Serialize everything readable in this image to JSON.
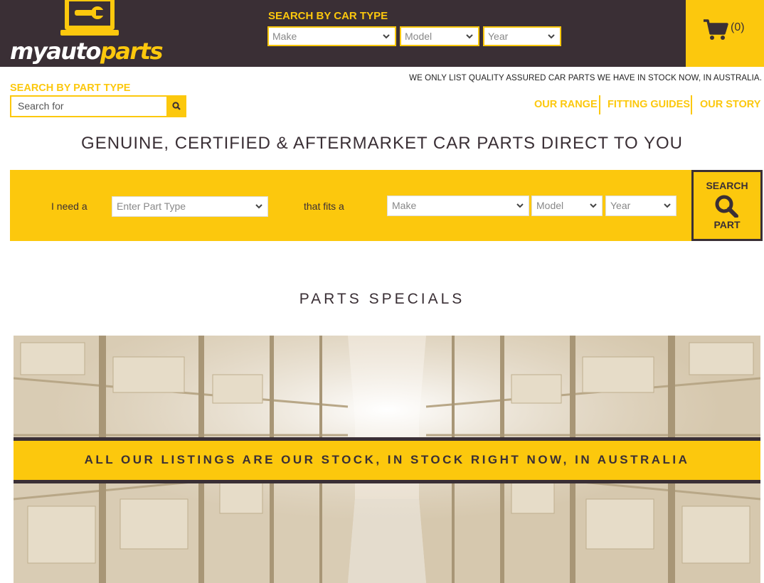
{
  "logo": {
    "text_white": "myauto",
    "text_yellow": "parts"
  },
  "header": {
    "search_by_car_title": "SEARCH BY CAR TYPE",
    "make": "Make",
    "model": "Model",
    "year": "Year",
    "cart_count": "(0)"
  },
  "tagline": "WE ONLY LIST QUALITY ASSURED CAR PARTS WE HAVE IN STOCK NOW, IN AUSTRALIA.",
  "part_search": {
    "title": "SEARCH BY PART TYPE",
    "placeholder": "Search for"
  },
  "nav": {
    "our_range": "OUR RANGE",
    "fitting_guides": "FITTING GUIDES",
    "our_story": "OUR STORY"
  },
  "headline": "GENUINE, CERTIFIED & AFTERMARKET CAR PARTS DIRECT TO YOU",
  "finder": {
    "need_label": "I need a",
    "part_placeholder": "Enter Part Type",
    "fits_label": "that fits a",
    "make": "Make",
    "model": "Model",
    "year": "Year",
    "button_top": "SEARCH",
    "button_bottom": "PART"
  },
  "specials": {
    "title": "PARTS SPECIALS",
    "banner": "ALL OUR LISTINGS ARE OUR STOCK, IN STOCK RIGHT NOW, IN AUSTRALIA"
  },
  "colors": {
    "brand_yellow": "#fcc80d",
    "brand_dark": "#3a2f35"
  }
}
